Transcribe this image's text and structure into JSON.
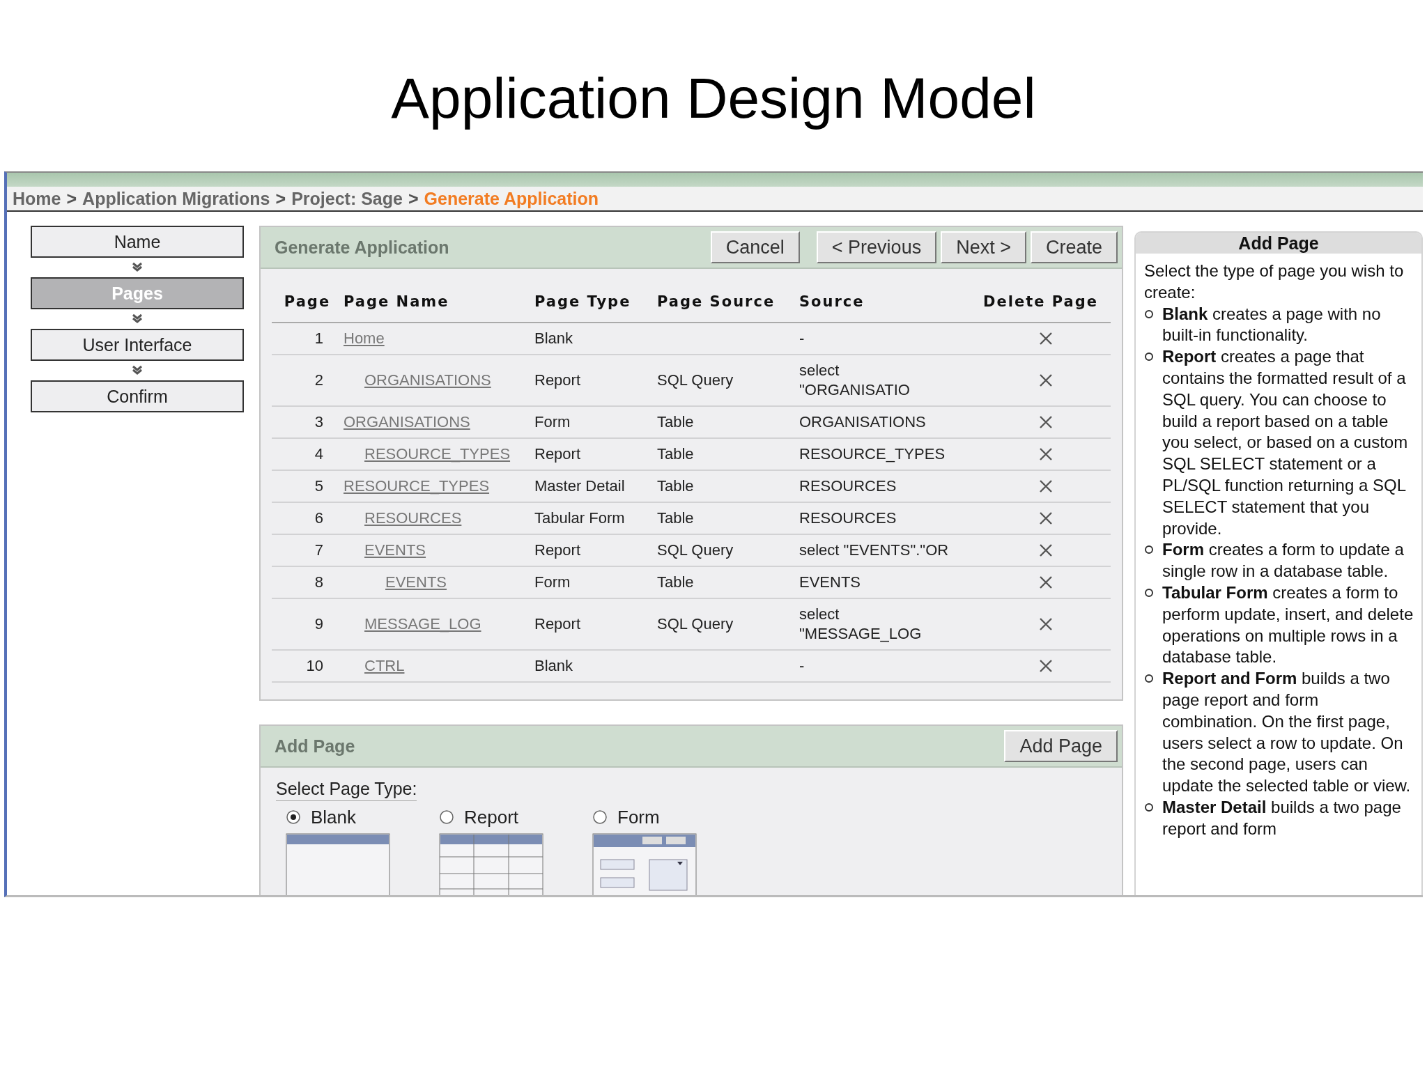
{
  "slide_title": "Application Design Model",
  "breadcrumbs": [
    {
      "label": "Home",
      "current": false,
      "separator": ">"
    },
    {
      "label": "Application Migrations",
      "current": false,
      "separator": ">"
    },
    {
      "label": "Project: Sage",
      "current": false,
      "separator": ">"
    },
    {
      "label": "Generate Application",
      "current": true
    }
  ],
  "wizard_steps": [
    {
      "label": "Name",
      "selected": false
    },
    {
      "label": "Pages",
      "selected": true
    },
    {
      "label": "User Interface",
      "selected": false
    },
    {
      "label": "Confirm",
      "selected": false
    }
  ],
  "generate_panel": {
    "title": "Generate Application",
    "buttons": [
      "Cancel",
      "< Previous",
      "Next >",
      "Create"
    ]
  },
  "table": {
    "columns": [
      "Page",
      "Page Name",
      "Page Type",
      "Page Source",
      "Source",
      "Delete Page"
    ],
    "rows": [
      {
        "page": "1",
        "name": "Home",
        "type": "Blank",
        "source": "-",
        "children": [
          {
            "page": "2",
            "name": "ORGANISATIONS",
            "type": "Report",
            "page_source": "SQL Query",
            "source": "select \"ORGANISATIO"
          }
        ]
      },
      {
        "page": "3",
        "name": "ORGANISATIONS",
        "type": "Form",
        "page_source": "Table",
        "source": "ORGANISATIONS",
        "children": [
          {
            "page": "4",
            "name": "RESOURCE_TYPES",
            "type": "Report",
            "page_source": "Table",
            "source": "RESOURCE_TYPES"
          }
        ]
      },
      {
        "page": "5",
        "name": "RESOURCE_TYPES",
        "type": "Master Detail",
        "page_source": "Table",
        "source": "RESOURCES",
        "children": [
          {
            "page": "6",
            "name": "RESOURCES",
            "type": "Tabular Form",
            "page_source": "Table",
            "source": "RESOURCES"
          },
          {
            "page": "7",
            "name": "EVENTS",
            "type": "Report",
            "page_source": "SQL Query",
            "source": "select \"EVENTS\".\"OR",
            "children": [
              {
                "page": "8",
                "name": "EVENTS",
                "type": "Form",
                "page_source": "Table",
                "source": "EVENTS"
              }
            ]
          },
          {
            "page": "9",
            "name": "MESSAGE_LOG",
            "type": "Report",
            "page_source": "SQL Query",
            "source": "select \"MESSAGE_LOG"
          },
          {
            "page": "10",
            "name": "CTRL",
            "type": "Blank",
            "source": "-"
          }
        ]
      }
    ]
  },
  "add_page_panel": {
    "title": "Add Page",
    "button": "Add Page",
    "label": "Select Page Type:",
    "options": [
      {
        "label": "Blank",
        "kind": "blank",
        "selected": true
      },
      {
        "label": "Report",
        "kind": "report",
        "selected": false
      },
      {
        "label": "Form",
        "kind": "form",
        "selected": false
      }
    ]
  },
  "help_panel": {
    "title": "Add Page",
    "intro": "Select the type of page you wish to create:",
    "items": [
      "**Blank** creates a page with no built-in functionality.",
      "**Report** creates a page that contains the formatted result of a SQL query. You can choose to build a report based on a table you select, or based on a custom SQL SELECT statement or a PL/SQL function returning a SQL SELECT statement that you provide.",
      "**Form** creates a form to update a single row in a database table.",
      "**Tabular Form** creates a form to perform update, insert, and delete operations on multiple rows in a database table.",
      "**Report and Form** builds a two page report and form combination. On the first page, users select a row to update. On the second page, users can update the selected table or view.",
      "**Master Detail** builds a two page report and form"
    ]
  }
}
